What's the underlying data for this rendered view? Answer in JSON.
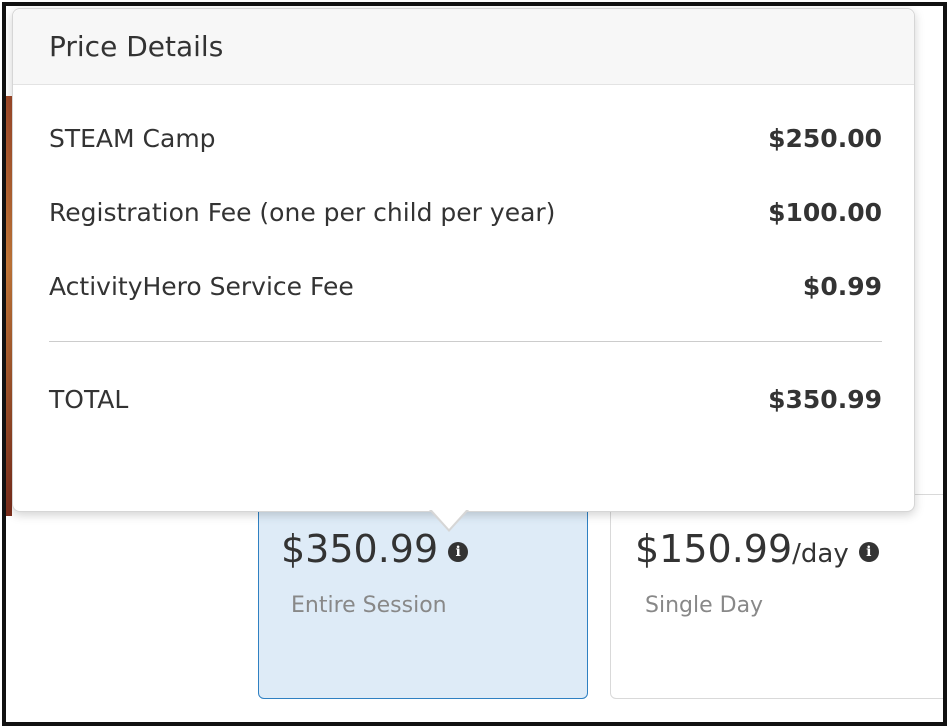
{
  "popover": {
    "title": "Price Details",
    "items": [
      {
        "name": "STEAM Camp",
        "amount": "$250.00"
      },
      {
        "name": "Registration Fee (one per child per year)",
        "amount": "$100.00"
      },
      {
        "name": "ActivityHero Service Fee",
        "amount": "$0.99"
      }
    ],
    "total_label": "TOTAL",
    "total_amount": "$350.99"
  },
  "price_options": [
    {
      "amount": "$350.99",
      "suffix": "",
      "label": "Entire Session",
      "selected": true
    },
    {
      "amount": "$150.99",
      "suffix": "/day",
      "label": "Single Day",
      "selected": false
    }
  ],
  "icons": {
    "info": "info-circle-icon"
  },
  "colors": {
    "selected_bg": "#deebf7",
    "selected_border": "#2f80c2",
    "text": "#333333",
    "muted": "#888888"
  }
}
